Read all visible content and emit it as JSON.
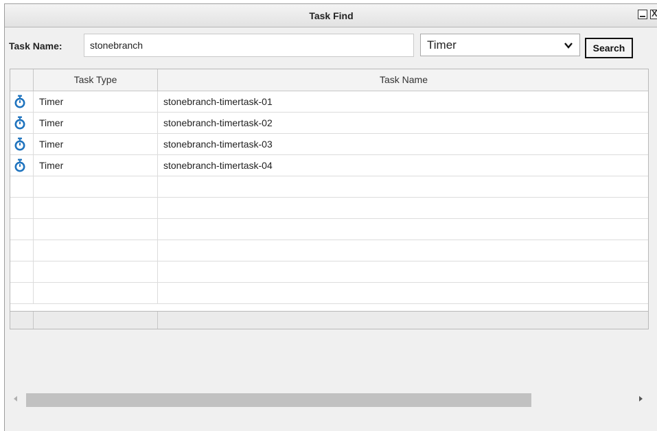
{
  "window": {
    "title": "Task Find"
  },
  "search": {
    "label": "Task Name:",
    "value": "stonebranch",
    "type_selected": "Timer",
    "button_label": "Search"
  },
  "grid": {
    "columns": [
      "",
      "Task Type",
      "Task Name"
    ],
    "rows": [
      {
        "icon": "timer-icon",
        "type": "Timer",
        "name": "stonebranch-timertask-01"
      },
      {
        "icon": "timer-icon",
        "type": "Timer",
        "name": "stonebranch-timertask-02"
      },
      {
        "icon": "timer-icon",
        "type": "Timer",
        "name": "stonebranch-timertask-03"
      },
      {
        "icon": "timer-icon",
        "type": "Timer",
        "name": "stonebranch-timertask-04"
      }
    ],
    "empty_rows": 6
  },
  "colors": {
    "icon_blue": "#1e73be",
    "panel_bg": "#f0f0f0",
    "grid_border": "#b9b9b9"
  }
}
